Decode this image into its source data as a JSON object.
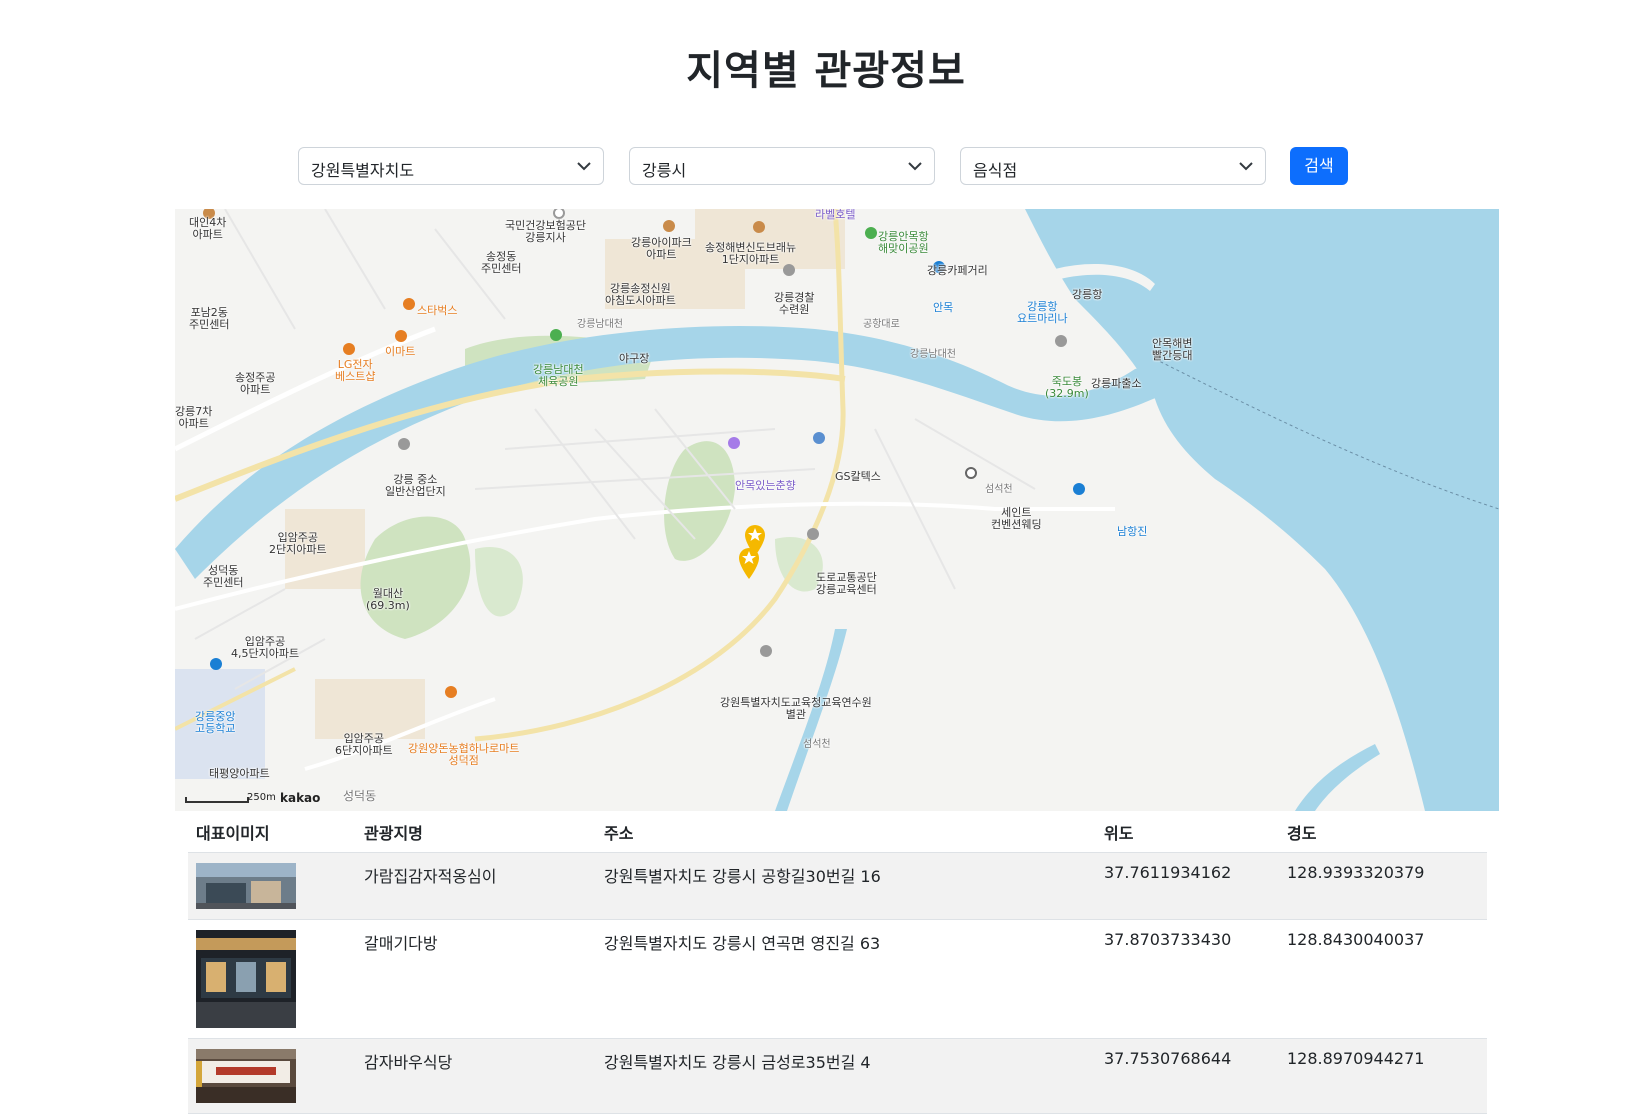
{
  "page": {
    "title": "지역별 관광정보"
  },
  "filters": {
    "province": "강원특별자치도",
    "city": "강릉시",
    "category": "음식점",
    "search_label": "검색"
  },
  "map": {
    "brand": "kakao",
    "scale_label": "250m",
    "labels": {
      "l1": "대인4차\n아파트",
      "l2": "국민건강보험공단\n강릉지사",
      "l3": "송정동\n주민센터",
      "l4": "강릉아이파크\n아파트",
      "l5": "송정해변신도브래뉴\n1단지아파트",
      "l6": "라벨호텔",
      "l7": "강릉안목항\n해맞이공원",
      "l8": "강릉카페거리",
      "l9": "강릉송정신원\n아침도시아파트",
      "l10": "강릉경찰\n수련원",
      "l11": "안목",
      "l12": "강릉항\n요트마리나",
      "l13": "강릉항",
      "l14": "포남2동\n주민센터",
      "l15": "스타벅스",
      "l16": "이마트",
      "l17": "LG전자\n베스트샵",
      "l18": "송정주공\n아파트",
      "l19": "강릉남대천\n체육공원",
      "l20": "야구장",
      "l21": "강릉7차\n아파트",
      "l22": "안목해변\n빨간등대",
      "l23": "죽도봉\n(32.9m)",
      "l24": "강릉파출소",
      "l25": "강릉 중소\n일반산업단지",
      "l26": "안목있는춘향",
      "l27": "GS칼텍스",
      "l28": "세인트\n컨벤션웨딩",
      "l29": "남항진",
      "l30": "입암주공\n2단지아파트",
      "l31": "성덕동\n주민센터",
      "l32": "월대산\n(69.3m)",
      "l33": "도로교통공단\n강릉교육센터",
      "l34": "입암주공\n4,5단지아파트",
      "l35": "강원특별자치도교육청교육연수원\n별관",
      "l36": "강릉중앙\n고등학교",
      "l37": "입암주공\n6단지아파트",
      "l38": "강원양돈농협하나로마트\n성덕점",
      "l39": "태평양아파트",
      "l40": "성덕동",
      "l41": "강릉남대천",
      "l42": "강릉남대천",
      "l43": "공항대로",
      "l44": "섬석천",
      "l45": "섬석천"
    }
  },
  "table": {
    "headers": [
      "대표이미지",
      "관광지명",
      "주소",
      "위도",
      "경도"
    ],
    "rows": [
      {
        "name": "가람집감자적옹심이",
        "address": "강원특별자치도 강릉시 공항길30번길 16",
        "lat": "37.7611934162",
        "lng": "128.9393320379",
        "image": "restaurant-exterior-photo"
      },
      {
        "name": "갈매기다방",
        "address": "강원특별자치도 강릉시 연곡면 영진길 63",
        "lat": "37.8703733430",
        "lng": "128.8430040037",
        "image": "cafe-night-photo"
      },
      {
        "name": "감자바우식당",
        "address": "강원특별자치도 강릉시 금성로35번길 4",
        "lat": "37.7530768644",
        "lng": "128.8970944271",
        "image": "restaurant-signboard-photo"
      }
    ]
  },
  "colors": {
    "accent": "#0d6efd",
    "water": "#a6d5e9",
    "park": "#cfe3c0",
    "marker": "#f5b800"
  }
}
